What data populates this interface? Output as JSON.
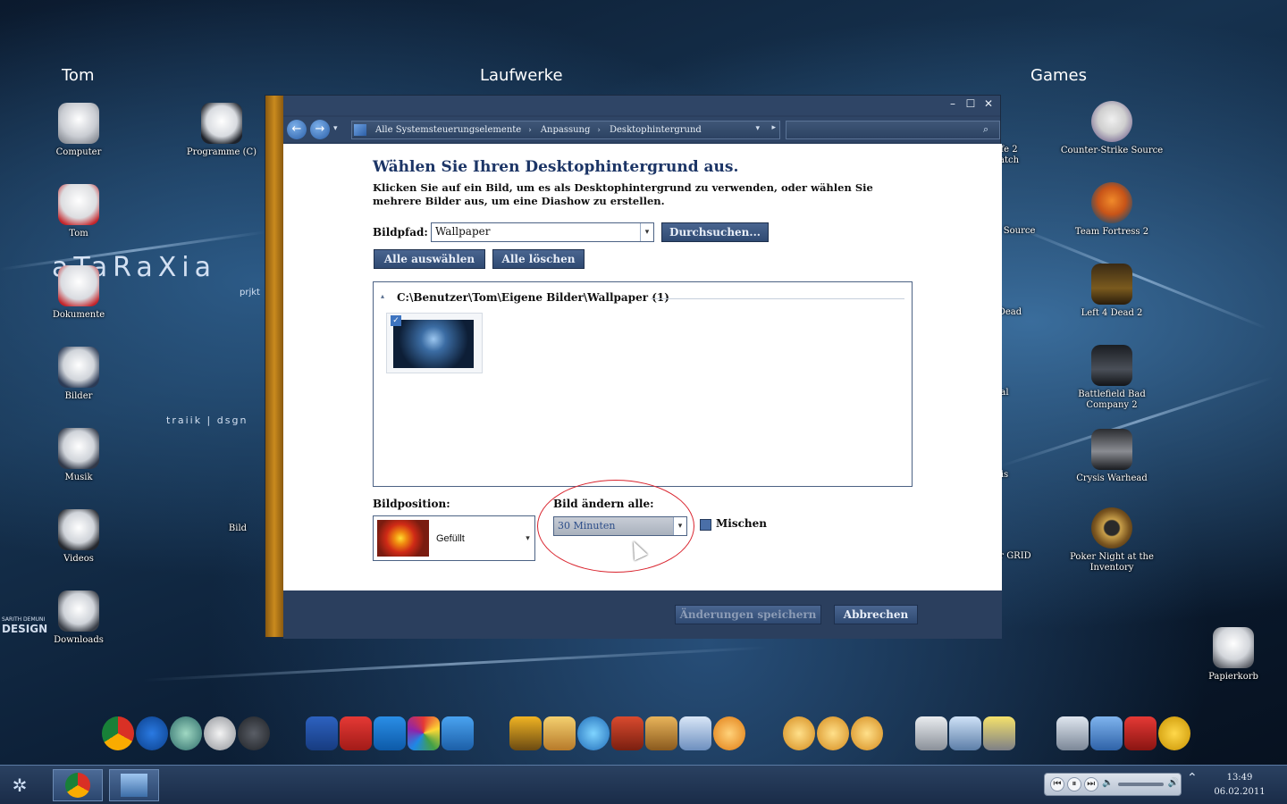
{
  "desktop": {
    "groups": [
      {
        "label": "Tom"
      },
      {
        "label": "Laufwerke"
      },
      {
        "label": "Games"
      }
    ],
    "left_icons": [
      "Computer",
      "Tom",
      "Dokumente",
      "Bilder",
      "Musik",
      "Videos",
      "Downloads"
    ],
    "second_column_icons": [
      "Programme (C)"
    ],
    "right_icons": [
      "Counter-Strike Source",
      "Team Fortress 2",
      "Left 4 Dead 2",
      "Battlefield Bad Company 2",
      "Crysis Warhead",
      "Poker Night at the Inventory"
    ],
    "partial_labels": [
      "fe 2",
      "atch",
      "at Source",
      "Dead",
      "al",
      "is",
      "er GRID",
      "Bild"
    ],
    "trash": "Papierkorb",
    "logo_main": "aTaRaXia",
    "logo_sub": "prjkt",
    "logo_credit": "traiik | dsgn",
    "logo_design_top": "SARITH DEMUNI",
    "logo_design": "DESIGN"
  },
  "window": {
    "breadcrumbs": [
      "Alle Systemsteuerungselemente",
      "Anpassung",
      "Desktophintergrund"
    ],
    "search_placeholder": "",
    "heading": "Wählen Sie Ihren Desktophintergrund aus.",
    "description": "Klicken Sie auf ein Bild, um es als Desktophintergrund zu verwenden, oder wählen Sie mehrere Bilder aus, um eine Diashow zu erstellen.",
    "path_label": "Bildpfad:",
    "path_value": "Wallpaper",
    "browse_button": "Durchsuchen...",
    "select_all_button": "Alle auswählen",
    "clear_all_button": "Alle löschen",
    "gallery_header": "C:\\Benutzer\\Tom\\Eigene Bilder\\Wallpaper (1)",
    "position_label": "Bildposition:",
    "position_value": "Gefüllt",
    "change_label": "Bild ändern alle:",
    "change_value": "30 Minuten",
    "shuffle_label": "Mischen",
    "save_button": "Änderungen speichern",
    "cancel_button": "Abbrechen"
  },
  "taskbar": {
    "time": "13:49",
    "date": "06.02.2011"
  },
  "colors": {
    "accent": "#2b3f5e",
    "highlight_circle": "#d9232d",
    "heading": "#1c3566"
  }
}
